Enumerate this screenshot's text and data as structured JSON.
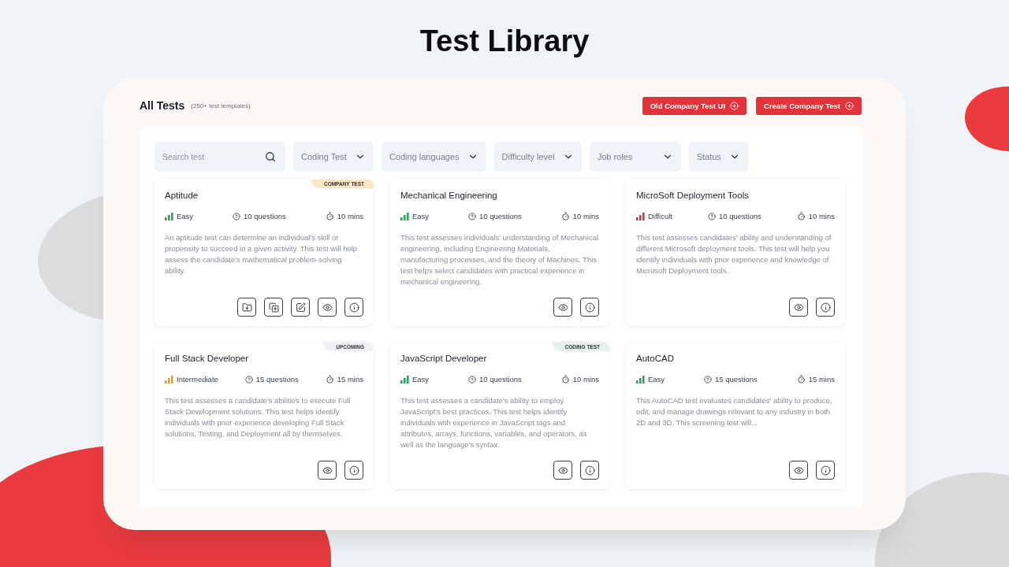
{
  "page_title": "Test Library",
  "header": {
    "title": "All Tests",
    "subtitle": "(250+ test templates)",
    "buttons": [
      "Old Company Test UI",
      "Create Company Test"
    ]
  },
  "search": {
    "placeholder": "Search test"
  },
  "filters": [
    "Coding Test",
    "Coding languages",
    "Difficulty level",
    "Job roles",
    "Status"
  ],
  "cards": [
    {
      "title": "Aptitude",
      "badge": {
        "kind": "company",
        "text": "COMPANY TEST"
      },
      "difficulty": {
        "kind": "easy",
        "text": "Easy"
      },
      "questions": "10 questions",
      "duration": "10 mins",
      "description": "An aptitude test can determine an individual's skill or propensity to succeed in a given activity. This test will help assess the candidate's mathematical problem-solving ability.",
      "actions": [
        {
          "kind": "save"
        },
        {
          "kind": "duplicate"
        },
        {
          "kind": "edit"
        },
        {
          "kind": "view"
        },
        {
          "kind": "info"
        }
      ]
    },
    {
      "title": "Mechanical Engineering",
      "difficulty": {
        "kind": "easy",
        "text": "Easy"
      },
      "questions": "10 questions",
      "duration": "10 mins",
      "description": "This test assesses individuals' understanding of Mechanical engineering, including Engineering Materials, manufacturing processes, and the theory of Machines. This test helps select candidates with practical experience in mechanical engineering.",
      "actions": [
        {
          "kind": "view"
        },
        {
          "kind": "info"
        }
      ]
    },
    {
      "title": "MicroSoft Deployment Tools",
      "difficulty": {
        "kind": "difficult",
        "text": "Difficult"
      },
      "questions": "10 questions",
      "duration": "10 mins",
      "description": "This test assesses candidates' ability and understanding of different Microsoft deployment tools. This test will help you identify individuals with prior experience and knowledge of Microsoft Deployment tools.",
      "actions": [
        {
          "kind": "view"
        },
        {
          "kind": "info"
        }
      ]
    },
    {
      "title": "Full Stack Developer",
      "badge": {
        "kind": "upcoming",
        "text": "UPCOMING"
      },
      "difficulty": {
        "kind": "intermediate",
        "text": "Intermediate"
      },
      "questions": "15 questions",
      "duration": "15 mins",
      "description": "This test assesses a candidate's abilities to execute Full Stack Development solutions. This test helps identify individuals with prior experience developing Full Stack solutions, Testing, and Deployment all by themselves.",
      "actions": [
        {
          "kind": "view"
        },
        {
          "kind": "info"
        }
      ]
    },
    {
      "title": "JavaScript Developer",
      "badge": {
        "kind": "coding",
        "text": "CODING TEST"
      },
      "difficulty": {
        "kind": "easy",
        "text": "Easy"
      },
      "questions": "10 questions",
      "duration": "10 mins",
      "description": "This test assesses a candidate's ability to employ JavaScript's best practices. This test helps identify individuals with experience in JavaScript tags and attributes, arrays, functions, variables, and operators, as well as the language's syntax.",
      "actions": [
        {
          "kind": "view"
        },
        {
          "kind": "info"
        }
      ]
    },
    {
      "title": "AutoCAD",
      "difficulty": {
        "kind": "easy",
        "text": "Easy"
      },
      "questions": "15 questions",
      "duration": "15 mins",
      "description": "This AutoCAD test evaluates candidates' ability to produce, edit, and manage drawings relevant to any industry in both 2D and 3D. This screening test will...",
      "actions": [
        {
          "kind": "view"
        },
        {
          "kind": "info"
        }
      ]
    }
  ]
}
